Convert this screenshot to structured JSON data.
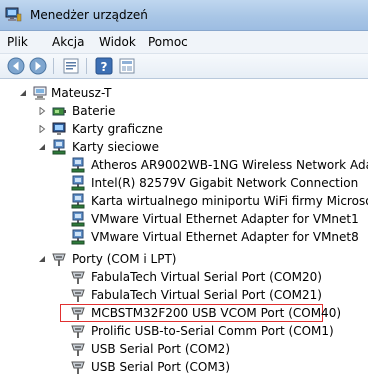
{
  "window": {
    "title": "Menedżer urządzeń"
  },
  "menu": [
    "Plik",
    "Akcja",
    "Widok",
    "Pomoc"
  ],
  "toolbar": [
    "back-arrow-icon",
    "forward-arrow-icon",
    "properties-icon",
    "help-icon",
    "details-icon"
  ],
  "tree": {
    "root": "Mateusz-T",
    "categories": {
      "batteries": "Baterie",
      "display": "Karty graficzne",
      "network": "Karty sieciowe",
      "ports": "Porty (COM i LPT)"
    },
    "network_adapters": [
      "Atheros AR9002WB-1NG Wireless Network Adapter",
      "Intel(R) 82579V Gigabit Network Connection",
      "Karta wirtualnego miniportu WiFi firmy Microsoft",
      "VMware Virtual Ethernet Adapter for VMnet1",
      "VMware Virtual Ethernet Adapter for VMnet8"
    ],
    "ports": [
      "FabulaTech Virtual Serial Port (COM20)",
      "FabulaTech Virtual Serial Port (COM21)",
      "MCBSTM32F200 USB VCOM Port (COM40)",
      "Prolific USB-to-Serial Comm Port (COM1)",
      "USB Serial Port (COM2)",
      "USB Serial Port (COM3)"
    ]
  },
  "colors": {
    "highlight_border": "#e03030"
  }
}
